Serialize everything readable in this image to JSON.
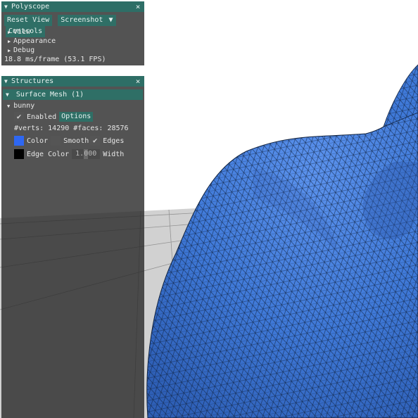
{
  "colors": {
    "title_bar": "#2e6e66",
    "button": "#2f6f66",
    "mesh_color": "#2e67f2",
    "edge_color": "#000000"
  },
  "polyscope": {
    "title": "Polyscope",
    "close_icon": "×",
    "buttons": {
      "reset_view": "Reset View",
      "screenshot": "Screenshot",
      "screenshot_arrow": "▼",
      "controls": "Controls"
    },
    "items": [
      {
        "label": "View"
      },
      {
        "label": "Appearance"
      },
      {
        "label": "Debug"
      }
    ],
    "status": "18.8 ms/frame (53.1 FPS)"
  },
  "structures": {
    "title": "Structures",
    "close_icon": "×",
    "group_label": "Surface Mesh (1)",
    "mesh": {
      "name": "bunny",
      "enabled_label": "Enabled",
      "options_label": "Options",
      "stats": "#verts: 14290  #faces: 28576",
      "color_label": "Color",
      "smooth_label": "Smooth",
      "edges_label": "Edges",
      "edge_color_label": "Edge Color",
      "width_value": "1.000",
      "width_label": "Width",
      "enabled": true,
      "smooth": false,
      "edges": true
    }
  }
}
